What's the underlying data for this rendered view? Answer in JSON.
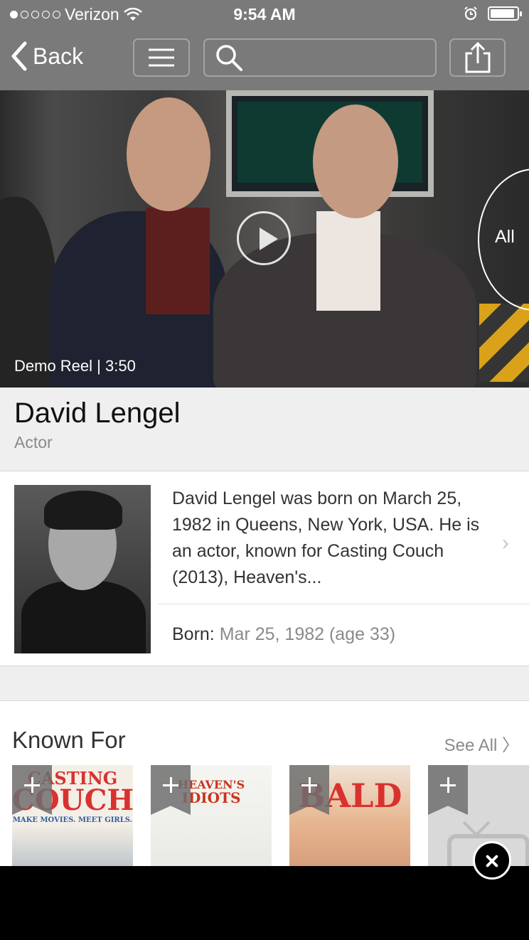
{
  "status_bar": {
    "carrier": "Verizon",
    "time": "9:54 AM",
    "battery_level": 0.92
  },
  "nav": {
    "back_label": "Back",
    "icons": [
      "chevron-left-icon",
      "menu-icon",
      "search-icon",
      "share-icon"
    ]
  },
  "hero": {
    "caption": "Demo Reel | 3:50",
    "all_label": "All"
  },
  "person": {
    "name": "David Lengel",
    "role": "Actor",
    "bio": "David Lengel was born on March 25, 1982 in Queens, New York, USA. He is an actor, known for Casting Couch (2013), Heaven's...",
    "born_label": "Born:",
    "born_value": "Mar 25, 1982 (age 33)"
  },
  "known_for": {
    "title": "Known For",
    "see_all": "See All",
    "posters": [
      {
        "top": "CASTING",
        "bottom": "COUCH",
        "tagline": "MAKE MOVIES. MEET GIRLS."
      },
      {
        "top": "HEAVEN'S",
        "bottom": "IDIOTS"
      },
      {
        "top": "BALD"
      }
    ]
  },
  "colors": {
    "nav_bg": "#7a7a7a",
    "page_bg": "#efefef",
    "secondary_text": "#8a8a8a",
    "add_ribbon": "#6e6e6e"
  }
}
